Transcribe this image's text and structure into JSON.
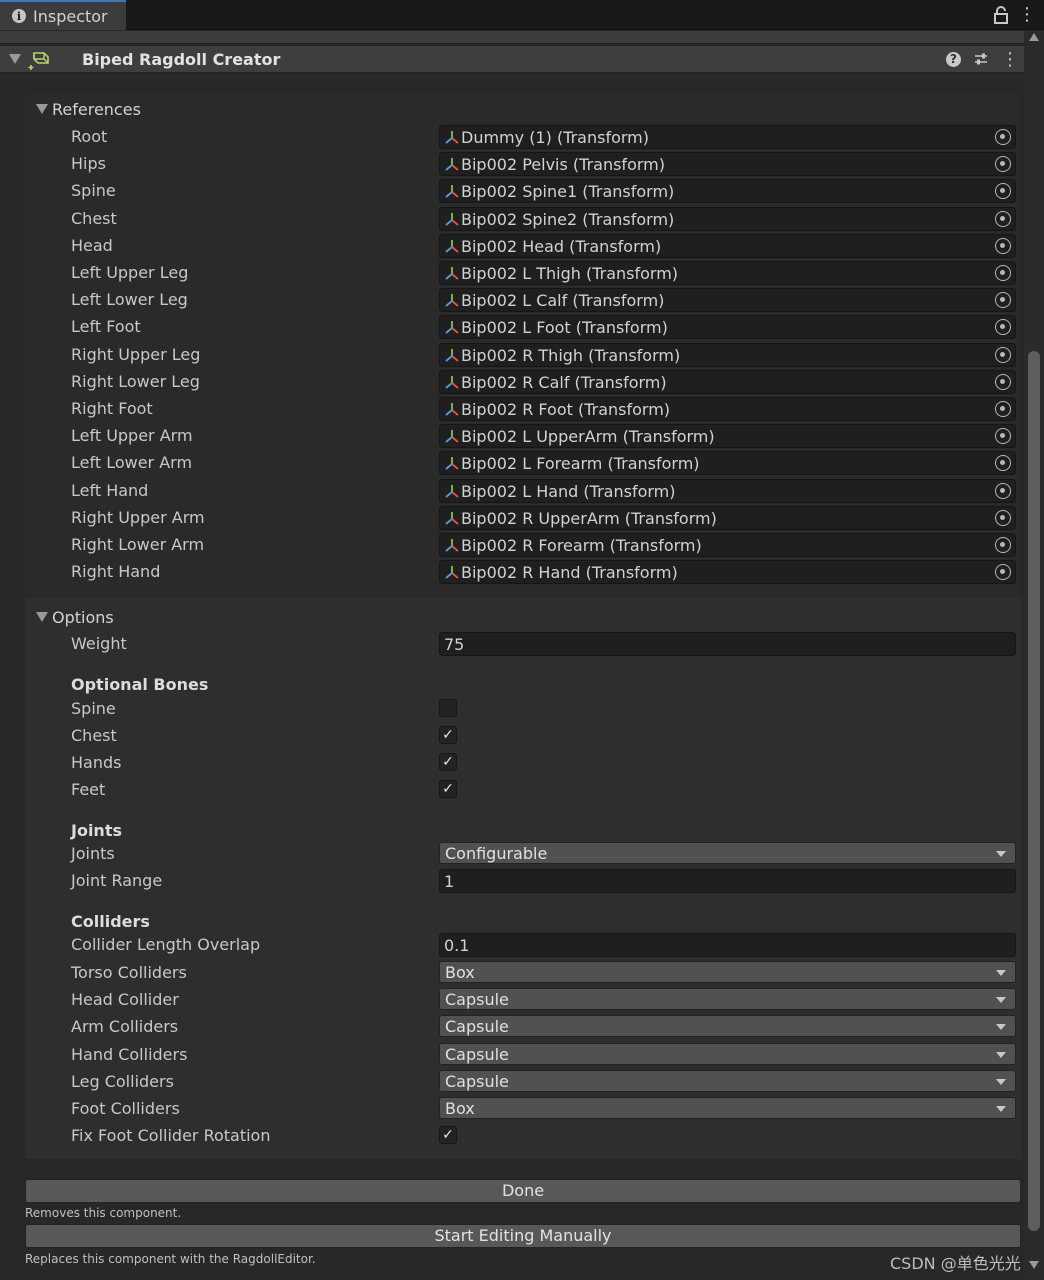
{
  "window": {
    "tab_title": "Inspector"
  },
  "component": {
    "title": "Biped Ragdoll Creator"
  },
  "references": {
    "section_title": "References",
    "fields": [
      {
        "label": "Root",
        "value": "Dummy (1) (Transform)"
      },
      {
        "label": "Hips",
        "value": "Bip002 Pelvis (Transform)"
      },
      {
        "label": "Spine",
        "value": "Bip002 Spine1 (Transform)"
      },
      {
        "label": "Chest",
        "value": "Bip002 Spine2 (Transform)"
      },
      {
        "label": "Head",
        "value": "Bip002 Head (Transform)"
      },
      {
        "label": "Left Upper Leg",
        "value": "Bip002 L Thigh (Transform)"
      },
      {
        "label": "Left Lower Leg",
        "value": "Bip002 L Calf (Transform)"
      },
      {
        "label": "Left Foot",
        "value": "Bip002 L Foot (Transform)"
      },
      {
        "label": "Right Upper Leg",
        "value": "Bip002 R Thigh (Transform)"
      },
      {
        "label": "Right Lower Leg",
        "value": "Bip002 R Calf (Transform)"
      },
      {
        "label": "Right Foot",
        "value": "Bip002 R Foot (Transform)"
      },
      {
        "label": "Left Upper Arm",
        "value": "Bip002 L UpperArm (Transform)"
      },
      {
        "label": "Left Lower Arm",
        "value": "Bip002 L Forearm (Transform)"
      },
      {
        "label": "Left Hand",
        "value": "Bip002 L Hand (Transform)"
      },
      {
        "label": "Right Upper Arm",
        "value": "Bip002 R UpperArm (Transform)"
      },
      {
        "label": "Right Lower Arm",
        "value": "Bip002 R Forearm (Transform)"
      },
      {
        "label": "Right Hand",
        "value": "Bip002 R Hand (Transform)"
      }
    ]
  },
  "options": {
    "section_title": "Options",
    "weight": {
      "label": "Weight",
      "value": "75"
    },
    "optional_bones": {
      "header": "Optional Bones",
      "items": [
        {
          "label": "Spine",
          "checked": false
        },
        {
          "label": "Chest",
          "checked": true
        },
        {
          "label": "Hands",
          "checked": true
        },
        {
          "label": "Feet",
          "checked": true
        }
      ]
    },
    "joints": {
      "header": "Joints",
      "joints_label": "Joints",
      "joints_value": "Configurable",
      "range_label": "Joint Range",
      "range_value": "1"
    },
    "colliders": {
      "header": "Colliders",
      "overlap_label": "Collider Length Overlap",
      "overlap_value": "0.1",
      "dropdowns": [
        {
          "label": "Torso Colliders",
          "value": "Box"
        },
        {
          "label": "Head Collider",
          "value": "Capsule"
        },
        {
          "label": "Arm Colliders",
          "value": "Capsule"
        },
        {
          "label": "Hand Colliders",
          "value": "Capsule"
        },
        {
          "label": "Leg Colliders",
          "value": "Capsule"
        },
        {
          "label": "Foot Colliders",
          "value": "Box"
        }
      ],
      "fix_rotation_label": "Fix Foot Collider Rotation",
      "fix_rotation_checked": true
    }
  },
  "buttons": {
    "done_label": "Done",
    "done_help": "Removes this component.",
    "manual_label": "Start Editing Manually",
    "manual_help": "Replaces this component with the RagdollEditor."
  },
  "icons": {
    "check_glyph": "✓",
    "menu_glyph": "⋮",
    "help_glyph": "?",
    "info_glyph": "i"
  },
  "watermark": "CSDN @单色光光"
}
